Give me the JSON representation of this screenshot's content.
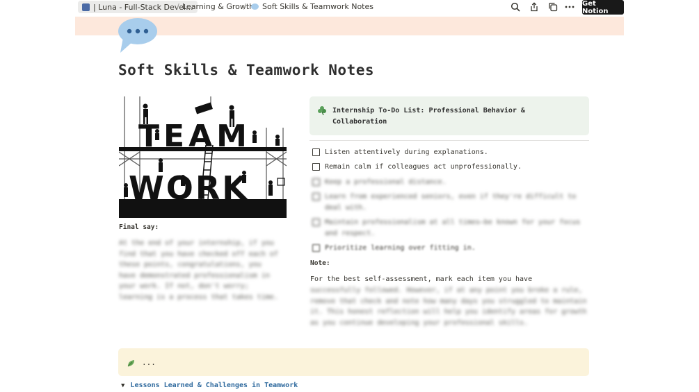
{
  "topbar": {
    "workspace_tab": "| Luna - Full-Stack Devel...",
    "breadcrumb_1": "Learning & Growth",
    "separator": "/",
    "breadcrumb_2": "Soft Skills & Teamwork Notes",
    "get_notion": "Get Notion",
    "icons": [
      "search-icon",
      "share-icon",
      "duplicate-icon",
      "more-icon"
    ]
  },
  "page": {
    "icon": "speech-bubble-icon",
    "icon_color": "#a8cdec",
    "cover_color": "#fde8dc",
    "title": "Soft Skills & Teamwork Notes"
  },
  "left_column": {
    "image_text_1": "TEAM",
    "image_text_2": "WORK",
    "final_say_label": "Final say:",
    "final_say_text": "At the end of your internship, if you find that you have checked off each of these points, congratulations, you have demonstrated professionalism in your work. If not, don't worry; learning is a process that takes time."
  },
  "callout": {
    "icon": "shamrock-icon",
    "text": "Internship To-Do List: Professional Behavior & Collaboration",
    "bg": "#edf3ec"
  },
  "todos": [
    {
      "label": "Listen attentively during explanations.",
      "checked": false
    },
    {
      "label": "Remain calm if colleagues act unprofessionally.",
      "checked": false
    },
    {
      "label": "Keep a professional distance.",
      "checked": false
    },
    {
      "label": "Learn from experienced seniors, even if they're difficult to deal with.",
      "checked": false
    },
    {
      "label": "Maintain professionalism at all times—be known for your focus and respect.",
      "checked": false
    },
    {
      "label": "Prioritize learning over fitting in.",
      "checked": false
    }
  ],
  "note": {
    "label": "Note:",
    "text_visible": "For the best self-assessment, mark each item you have",
    "text_blurred": "successfully followed. However, if at any point you broke a rule, remove that check and note how many days you struggled to maintain it. This honest reflection will help you identify areas for growth as you continue developing your professional skills."
  },
  "yellow_callout": {
    "icon": "leaf-icon",
    "text": "...",
    "bg": "#fbf3db"
  },
  "toggle": {
    "arrow": "▼",
    "label": "Lessons Learned & Challenges in Teamwork"
  }
}
